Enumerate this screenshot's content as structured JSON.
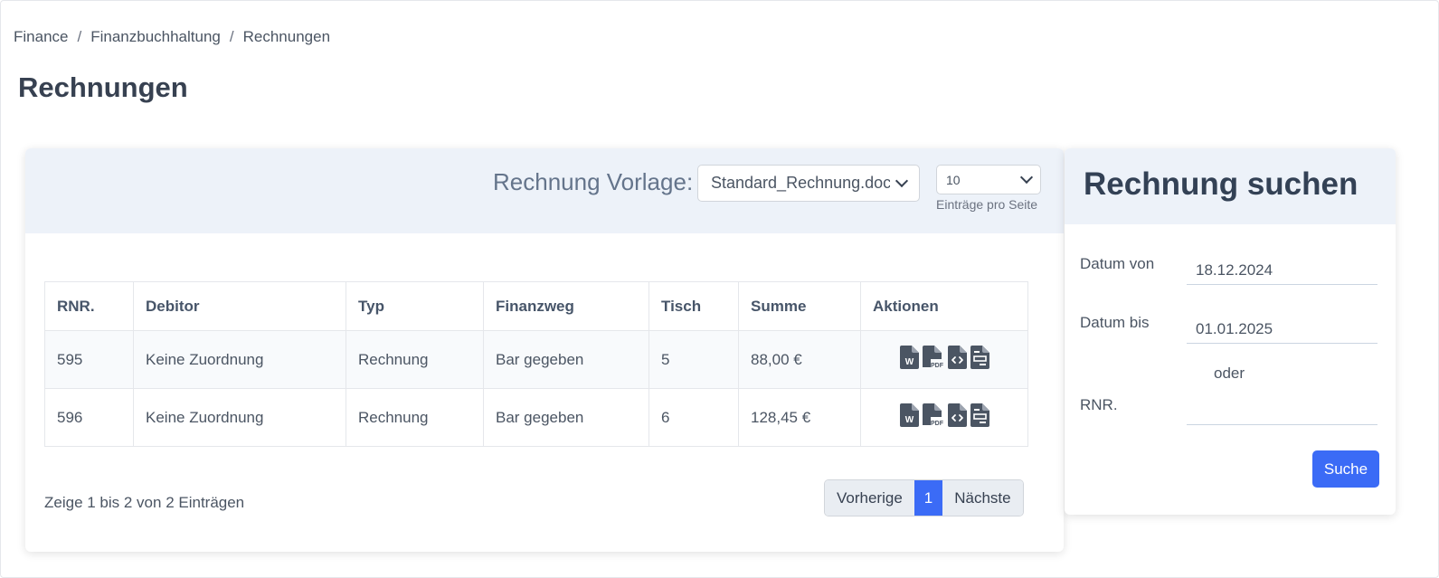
{
  "breadcrumb": {
    "items": [
      "Finance",
      "Finanzbuchhaltung",
      "Rechnungen"
    ],
    "separator": "/"
  },
  "page_title": "Rechnungen",
  "toolbar": {
    "template_label": "Rechnung Vorlage:",
    "template_value": "Standard_Rechnung.docx",
    "per_page_value": "10",
    "per_page_label": "Einträge pro Seite"
  },
  "table": {
    "headers": [
      "RNR.",
      "Debitor",
      "Typ",
      "Finanzweg",
      "Tisch",
      "Summe",
      "Aktionen"
    ],
    "rows": [
      [
        "595",
        "Keine Zuordnung",
        "Rechnung",
        "Bar gegeben",
        "5",
        "88,00 €"
      ],
      [
        "596",
        "Keine Zuordnung",
        "Rechnung",
        "Bar gegeben",
        "6",
        "128,45 €"
      ]
    ],
    "action_icons": [
      "word-file-icon",
      "pdf-file-icon",
      "code-file-icon",
      "receipt-file-icon"
    ],
    "icon_labels": {
      "word": "W",
      "pdf": "PDF"
    }
  },
  "pagination": {
    "info": "Zeige 1 bis 2 von 2 Einträgen",
    "prev": "Vorherige",
    "current": "1",
    "next": "Nächste"
  },
  "search": {
    "title": "Rechnung suchen",
    "date_from_label": "Datum von",
    "date_from_value": "18.12.2024",
    "date_to_label": "Datum bis",
    "date_to_value": "01.01.2025",
    "or_label": "oder",
    "rnr_label": "RNR.",
    "rnr_value": "",
    "button": "Suche"
  },
  "colors": {
    "accent": "#3b6bf6",
    "header_bg": "#edf2f9",
    "icon": "#4b5563"
  }
}
